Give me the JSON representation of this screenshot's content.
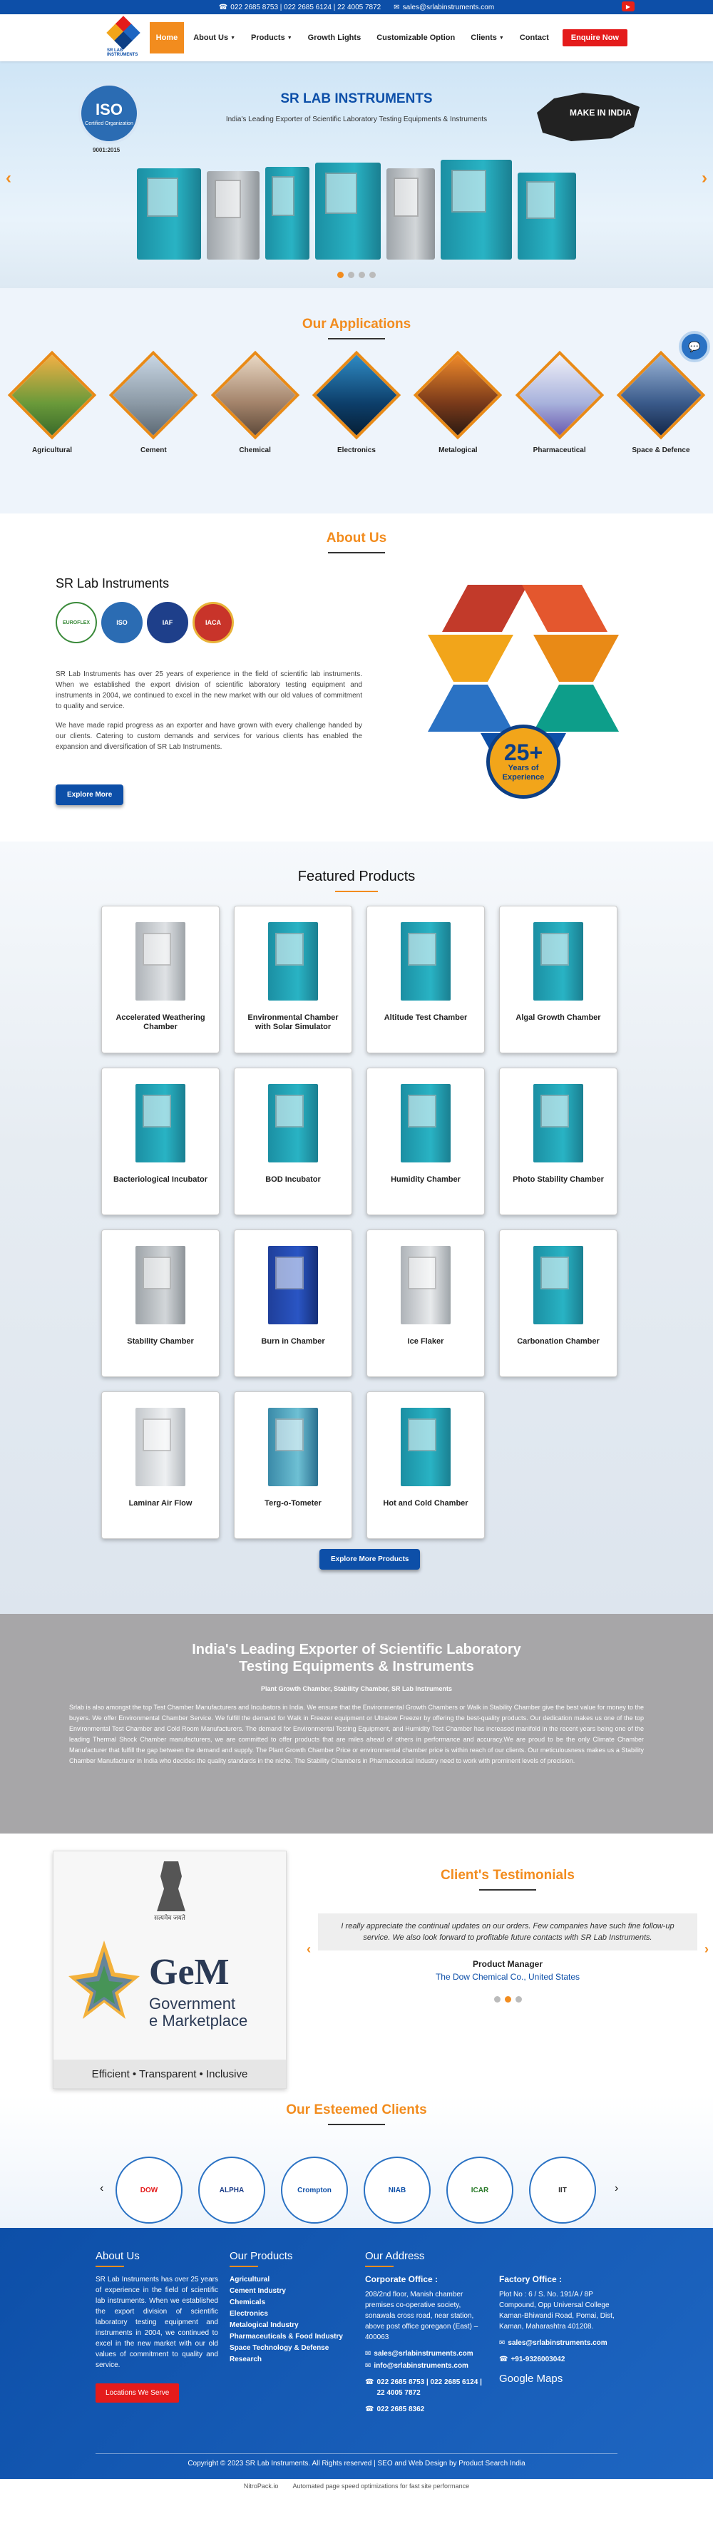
{
  "topbar": {
    "phone": "022 2685 8753 | 022 2685 6124 | 22 4005 7872",
    "email": "sales@srlabinstruments.com"
  },
  "nav": {
    "logo_caption": "SR LAB INSTRUMENTS",
    "items": [
      "Home",
      "About Us",
      "Products",
      "Growth Lights",
      "Customizable Option",
      "Clients",
      "Contact"
    ],
    "enquire": "Enquire Now"
  },
  "hero": {
    "title": "SR LAB INSTRUMENTS",
    "subtitle": "India's Leading Exporter of Scientific Laboratory Testing Equipments & Instruments",
    "iso_text": "ISO",
    "iso_caption": "Certified Organization",
    "iso_code": "9001:2015",
    "make_in_india": "MAKE IN INDIA"
  },
  "applications": {
    "title": "Our Applications",
    "items": [
      "Agricultural",
      "Cement",
      "Chemical",
      "Electronics",
      "Metalogical",
      "Pharmaceutical",
      "Space & Defence"
    ]
  },
  "about": {
    "title": "About Us",
    "heading": "SR Lab Instruments",
    "certs": [
      "EUROFLEX",
      "ISO",
      "IAF",
      "IACA"
    ],
    "p1": "SR Lab Instruments has over 25 years of experience in the field of scientific lab instruments. When we established the export division of scientific laboratory testing equipment and instruments in 2004, we continued to excel in the new market with our old values of commitment to quality and service.",
    "p2": "We have made rapid progress as an exporter and have grown with every challenge handed by our clients. Catering to custom demands and services for various clients has enabled the expansion and diversification of SR Lab Instruments.",
    "button": "Explore More",
    "badge_number": "25+",
    "badge_text": "Years of Experience"
  },
  "featured": {
    "title": "Featured Products",
    "products": [
      "Accelerated Weathering Chamber",
      "Environmental Chamber with Solar Simulator",
      "Altitude Test Chamber",
      "Algal Growth Chamber",
      "Bacteriological Incubator",
      "BOD Incubator",
      "Humidity Chamber",
      "Photo Stability Chamber",
      "Stability Chamber",
      "Burn in Chamber",
      "Ice Flaker",
      "Carbonation Chamber",
      "Laminar Air Flow",
      "Terg-o-Tometer",
      "Hot and Cold Chamber"
    ],
    "button": "Explore More Products"
  },
  "info": {
    "title_line1": "India's Leading Exporter of Scientific Laboratory",
    "title_line2": "Testing Equipments & Instruments",
    "tags": "Plant Growth Chamber, Stability Chamber, SR Lab Instruments",
    "body": "Srlab is also amongst the top Test Chamber Manufacturers and Incubators in India. We ensure that the Environmental Growth Chambers or Walk in Stability Chamber give the best value for money to the buyers. We offer Environmental Chamber Service. We fulfill the demand for Walk in Freezer equipment or Ultralow Freezer by offering the best-quality products. Our dedication makes us one of the top Environmental Test Chamber and Cold Room Manufacturers. The demand for Environmental Testing Equipment, and Humidity Test Chamber has increased manifold in the recent years being one of the leading Thermal Shock Chamber manufacturers, we are committed to offer products that are miles ahead of others in performance and accuracy.We are proud to be the only Climate Chamber Manufacturer that fulfill the gap between the demand and supply. The Plant Growth Chamber Price or environmental chamber price is within reach of our clients. Our meticulousness makes us a Stability Chamber Manufacturer in India who decides the quality standards in the niche. The Stability Chambers in Pharmaceutical Industry need to work with prominent levels of precision."
  },
  "gem": {
    "hindi": "सत्यमेव जयते",
    "title": "GeM",
    "sub1": "Government",
    "sub2": "e Marketplace",
    "tag": "Efficient • Transparent • Inclusive"
  },
  "testimonials": {
    "title": "Client's Testimonials",
    "quote": "I really appreciate the continual updates on our orders. Few companies have such fine follow-up service. We also look forward to profitable future contacts with SR Lab Instruments.",
    "name": "Product Manager",
    "company": "The Dow Chemical Co., United States"
  },
  "clients": {
    "title": "Our Esteemed Clients",
    "logos": [
      "DOW",
      "ALPHA",
      "Crompton",
      "NIAB",
      "ICAR",
      "IIT"
    ]
  },
  "footer": {
    "about_title": "About Us",
    "about_text": "SR Lab Instruments has over 25 years of experience in the field of scientific lab instruments. When we established the export division of scientific laboratory testing equipment and instruments in 2004, we continued to excel in the new market with our old values of commitment to quality and service.",
    "locations": "Locations We Serve",
    "products_title": "Our Products",
    "products": [
      "Agricultural",
      "Cement Industry",
      "Chemicals",
      "Electronics",
      "Metalogical Industry",
      "Pharmaceuticals & Food Industry",
      "Space Technology & Defense Research"
    ],
    "address_title": "Our Address",
    "corporate_title": "Corporate Office :",
    "corporate": "208/2nd floor, Manish chamber premises co-operative society, sonawala cross road, near station, above post office goregaon (East) – 400063",
    "email1": "sales@srlabinstruments.com",
    "email2": "info@srlabinstruments.com",
    "phone1": "022 2685 8753 | 022 2685 6124 | 22 4005 7872",
    "phone2": "022 2685 8362",
    "factory_title": "Factory Office :",
    "factory": "Plot No : 6 / S. No. 191/A / 8P Compound, Opp Universal College Kaman-Bhiwandi Road, Pomai, Dist, Kaman, Maharashtra 401208.",
    "factory_email": "sales@srlabinstruments.com",
    "factory_phone": "+91-9326003042",
    "maps": "Google Maps",
    "copyright": "Copyright © 2023 SR Lab Instruments. All Rights reserved | SEO and Web Design by Product Search India"
  },
  "strip": {
    "brand": "NitroPack.io",
    "text": "Automated page speed optimizations for fast site performance"
  },
  "colors": {
    "primary": "#0d4fa8",
    "accent": "#f28c1e",
    "red": "#e41b1b"
  }
}
